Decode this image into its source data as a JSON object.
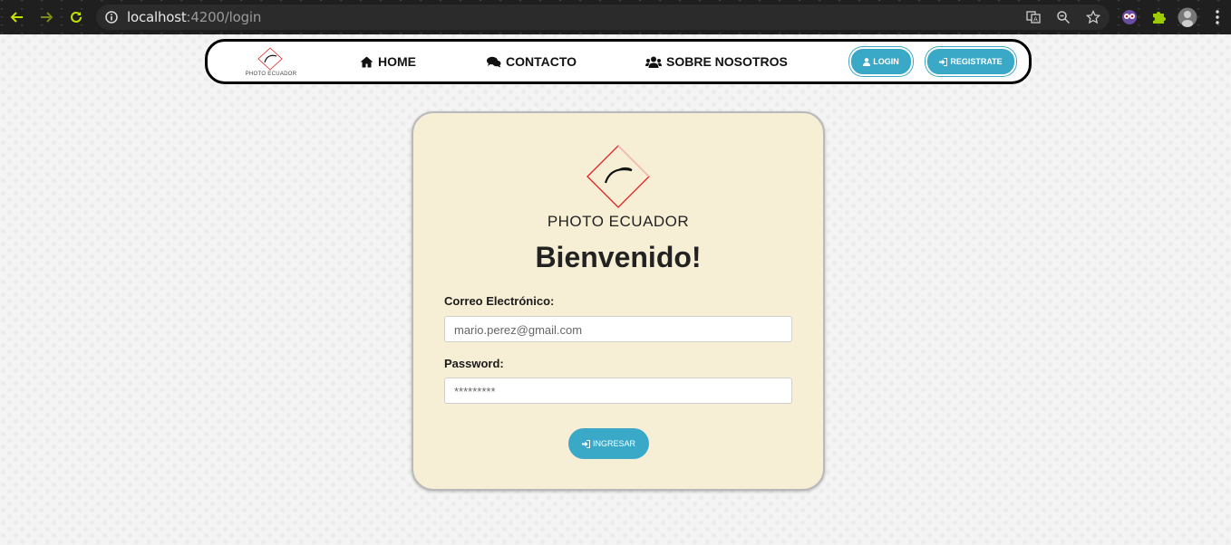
{
  "browser": {
    "url_host": "localhost",
    "url_rest": ":4200/login"
  },
  "navbar": {
    "brand_text": "PHOTO ECUADOR",
    "links": [
      {
        "label": "HOME",
        "icon": "home-icon"
      },
      {
        "label": "CONTACTO",
        "icon": "comments-icon"
      },
      {
        "label": "SOBRE NOSOTROS",
        "icon": "users-icon"
      }
    ],
    "login_label": "LOGIN",
    "register_label": "REGISTRATE"
  },
  "card": {
    "logo_text": "PHOTO ECUADOR",
    "welcome": "Bienvenido!",
    "email_label": "Correo Electrónico:",
    "email_placeholder": "mario.perez@gmail.com",
    "password_label": "Password:",
    "password_placeholder": "*********",
    "submit_label": "INGRESAR"
  },
  "colors": {
    "accent": "#3aa9c8",
    "card_bg": "#f6efd6",
    "logo_red": "#e02020"
  }
}
